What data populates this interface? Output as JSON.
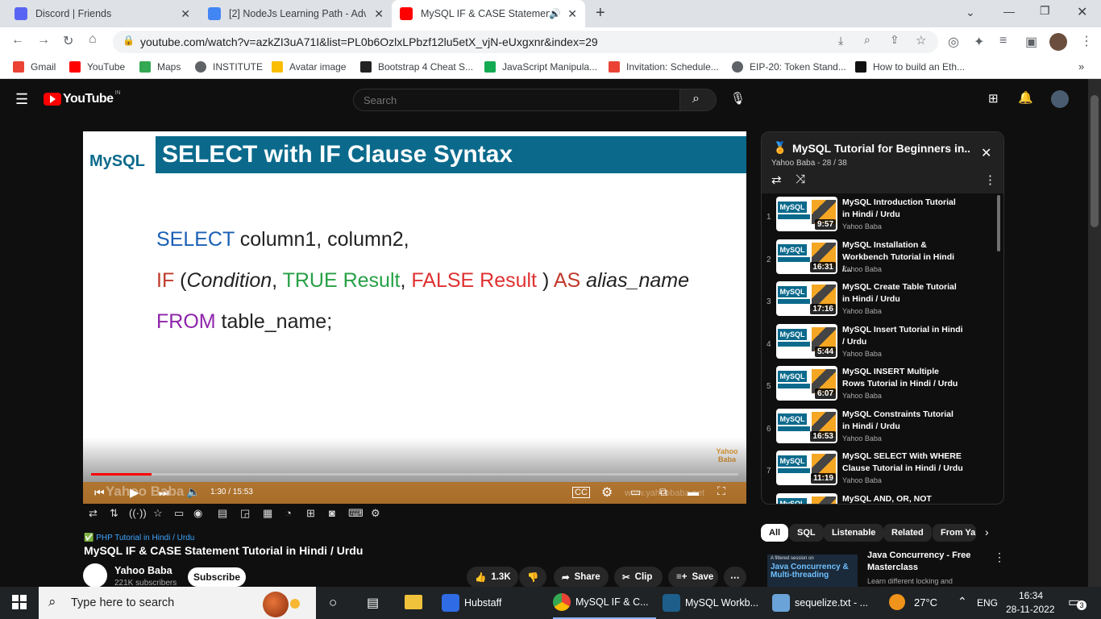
{
  "browser": {
    "tabs": [
      {
        "title": "Discord | Friends",
        "fav_color": "#5865f2"
      },
      {
        "title": "[2] NodeJs Learning Path - Advan",
        "fav_color": "#4285f4"
      },
      {
        "title": "MySQL IF & CASE Statement",
        "fav_color": "#ff0000"
      }
    ],
    "url": "youtube.com/watch?v=azkZI3uA71I&list=PL0b6OzlxLPbzf12lu5etX_vjN-eUxgxnr&index=29",
    "bookmarks": [
      {
        "label": "Gmail",
        "color": "#ea4335"
      },
      {
        "label": "YouTube",
        "color": "#ff0000"
      },
      {
        "label": "Maps",
        "color": "#34a853"
      },
      {
        "label": "INSTITUTE",
        "color": "#5f6368"
      },
      {
        "label": "Avatar image",
        "color": "#fbbc04"
      },
      {
        "label": "Bootstrap 4 Cheat S...",
        "color": "#222222"
      },
      {
        "label": "JavaScript Manipula...",
        "color": "#13aa52"
      },
      {
        "label": "Invitation: Schedule...",
        "color": "#ea4335"
      },
      {
        "label": "EIP-20: Token Stand...",
        "color": "#5f6368"
      },
      {
        "label": "How to build an Eth...",
        "color": "#111111"
      }
    ]
  },
  "youtube": {
    "logo": "YouTube",
    "region": "IN",
    "search_placeholder": "Search",
    "player": {
      "slide_title": "SELECT with IF Clause Syntax",
      "mysql_logo": "MySQL",
      "line1_kw": "SELECT",
      "line1_rest": " column1, column2,",
      "line2_if": "IF",
      "line2_open": " (",
      "line2_cond": "Condition",
      "line2_comma1": ", ",
      "line2_true": "TRUE Result",
      "line2_comma2": ", ",
      "line2_false": "FALSE Result",
      "line2_close": " ) ",
      "line2_as": "AS",
      "line2_alias": " alias_name",
      "line3_kw": "FROM",
      "line3_rest": " table_name;",
      "watermark": "Yahoo Baba",
      "time": "1:30 / 15:53",
      "progress_fraction": 0.094,
      "site": "www.yahoobaba.net"
    },
    "video": {
      "playlist_tag": "PHP Tutorial in Hindi / Urdu",
      "title": "MySQL IF & CASE Statement Tutorial in Hindi / Urdu",
      "channel": "Yahoo Baba",
      "subscribers": "221K subscribers",
      "subscribe_label": "Subscribe",
      "likes": "1.3K",
      "share": "Share",
      "clip": "Clip",
      "save": "Save"
    },
    "playlist": {
      "title": "MySQL Tutorial for Beginners in...",
      "subtitle": "Yahoo Baba - 28 / 38",
      "items": [
        {
          "n": "1",
          "title": "MySQL Introduction Tutorial in Hindi / Urdu",
          "channel": "Yahoo Baba",
          "duration": "9:57"
        },
        {
          "n": "2",
          "title": "MySQL Installation & Workbench Tutorial in Hindi /...",
          "channel": "Yahoo Baba",
          "duration": "16:31"
        },
        {
          "n": "3",
          "title": "MySQL Create Table Tutorial in Hindi / Urdu",
          "channel": "Yahoo Baba",
          "duration": "17:16"
        },
        {
          "n": "4",
          "title": "MySQL Insert Tutorial in Hindi / Urdu",
          "channel": "Yahoo Baba",
          "duration": "5:44"
        },
        {
          "n": "5",
          "title": "MySQL INSERT Multiple Rows Tutorial in Hindi / Urdu",
          "channel": "Yahoo Baba",
          "duration": "6:07"
        },
        {
          "n": "6",
          "title": "MySQL Constraints Tutorial in Hindi / Urdu",
          "channel": "Yahoo Baba",
          "duration": "16:53"
        },
        {
          "n": "7",
          "title": "MySQL SELECT With WHERE Clause Tutorial in Hindi / Urdu",
          "channel": "Yahoo Baba",
          "duration": "11:19"
        },
        {
          "n": "",
          "title": "MySQL AND, OR, NOT",
          "channel": "",
          "duration": ""
        }
      ]
    },
    "chips": [
      "All",
      "SQL",
      "Listenable",
      "Related",
      "From Ya"
    ],
    "recommendation": {
      "thumb_small": "A filtered session on",
      "thumb_big": "Java Concurrency & Multi-threading",
      "title": "Java Concurrency - Free Masterclass",
      "desc": "Learn different locking and"
    }
  },
  "taskbar": {
    "search": "Type here to search",
    "apps": [
      {
        "label": "Hubstaff",
        "color": "#2f6be4"
      },
      {
        "label": "MySQL IF & C...",
        "color": "#ea4335"
      },
      {
        "label": "MySQL Workb...",
        "color": "#1d5e8b"
      },
      {
        "label": "sequelize.txt - ...",
        "color": "#6aa3d8"
      }
    ],
    "weather": "27°C",
    "lang": "ENG",
    "time": "16:34",
    "date": "28-11-2022",
    "notifications": "3"
  }
}
